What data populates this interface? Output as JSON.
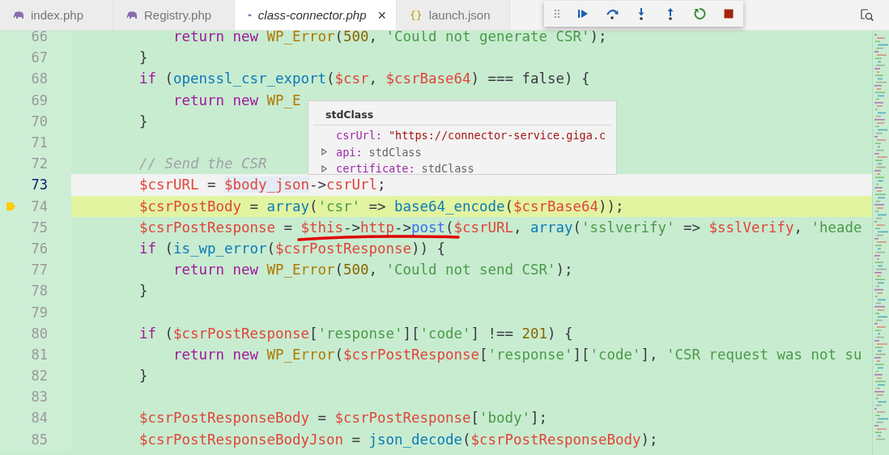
{
  "tabs": [
    {
      "label": "index.php",
      "kind": "php",
      "selected": false
    },
    {
      "label": "Registry.php",
      "kind": "php",
      "selected": false
    },
    {
      "label": "class-connector.php",
      "kind": "php",
      "selected": true,
      "close": "×"
    },
    {
      "label": "launch.json",
      "kind": "json",
      "glyph": "{}",
      "selected": false
    }
  ],
  "editor": {
    "lines": [
      {
        "number": "66",
        "kind": "plain",
        "tokens": [
          {
            "kind": "kw",
            "text": "            return"
          },
          {
            "kind": "kw",
            "text": " new"
          },
          {
            "kind": "cls",
            "text": " WP_Error"
          },
          {
            "kind": "p",
            "text": "("
          },
          {
            "kind": "num",
            "text": "500"
          },
          {
            "kind": "p",
            "text": ", "
          },
          {
            "kind": "str",
            "text": "'Could not generate CSR'"
          },
          {
            "kind": "p",
            "text": ");"
          }
        ]
      },
      {
        "number": "67",
        "kind": "plain",
        "tokens": [
          {
            "kind": "p",
            "text": "        }"
          }
        ]
      },
      {
        "number": "68",
        "kind": "plain",
        "tokens": [
          {
            "kind": "kw",
            "text": "        if"
          },
          {
            "kind": "p",
            "text": " ("
          },
          {
            "kind": "fn",
            "text": "openssl_csr_export"
          },
          {
            "kind": "p",
            "text": "("
          },
          {
            "kind": "var",
            "text": "$csr"
          },
          {
            "kind": "p",
            "text": ", "
          },
          {
            "kind": "var",
            "text": "$csrBase64"
          },
          {
            "kind": "p",
            "text": ") === false) {"
          }
        ]
      },
      {
        "number": "69",
        "kind": "plain",
        "tokens": [
          {
            "kind": "kw",
            "text": "            return"
          },
          {
            "kind": "kw",
            "text": " new"
          },
          {
            "kind": "cls",
            "text": " WP_E"
          }
        ]
      },
      {
        "number": "70",
        "kind": "plain",
        "tokens": [
          {
            "kind": "p",
            "text": "        }"
          }
        ]
      },
      {
        "number": "71",
        "kind": "plain"
      },
      {
        "number": "72",
        "kind": "plain",
        "tokens": [
          {
            "kind": "cmt",
            "text": "        // Send the CSR"
          }
        ]
      },
      {
        "number": "73",
        "kind": "cursor",
        "tokens": [
          {
            "kind": "var",
            "text": "        $csrURL"
          },
          {
            "kind": "p",
            "text": " = "
          },
          {
            "kind": "var-hover",
            "text": "$body_json"
          },
          {
            "kind": "p",
            "text": "->"
          },
          {
            "kind": "var",
            "text": "csrUrl"
          },
          {
            "kind": "p",
            "text": ";"
          }
        ]
      },
      {
        "number": "74",
        "kind": "paused",
        "tokens": [
          {
            "kind": "var",
            "text": "        $csrPostBody"
          },
          {
            "kind": "p",
            "text": " = "
          },
          {
            "kind": "fn",
            "text": "array"
          },
          {
            "kind": "p",
            "text": "("
          },
          {
            "kind": "str",
            "text": "'csr'"
          },
          {
            "kind": "p",
            "text": " => "
          },
          {
            "kind": "fn",
            "text": "base64_encode"
          },
          {
            "kind": "p",
            "text": "("
          },
          {
            "kind": "var",
            "text": "$csrBase64"
          },
          {
            "kind": "p",
            "text": "));"
          }
        ]
      },
      {
        "number": "75",
        "kind": "plain",
        "tokens": [
          {
            "kind": "var",
            "text": "        $csrPostResponse"
          },
          {
            "kind": "p",
            "text": " = "
          },
          {
            "kind": "var",
            "text": "$this"
          },
          {
            "kind": "p",
            "text": "->"
          },
          {
            "kind": "var",
            "text": "http"
          },
          {
            "kind": "p",
            "text": "->"
          },
          {
            "kind": "method",
            "text": "post"
          },
          {
            "kind": "p",
            "text": "("
          },
          {
            "kind": "var",
            "text": "$csrURL"
          },
          {
            "kind": "p",
            "text": ", "
          },
          {
            "kind": "fn",
            "text": "array"
          },
          {
            "kind": "p",
            "text": "("
          },
          {
            "kind": "str",
            "text": "'sslverify'"
          },
          {
            "kind": "p",
            "text": " => "
          },
          {
            "kind": "var",
            "text": "$sslVerify"
          },
          {
            "kind": "p",
            "text": ", "
          },
          {
            "kind": "str",
            "text": "'heade"
          }
        ]
      },
      {
        "number": "76",
        "kind": "plain",
        "tokens": [
          {
            "kind": "kw",
            "text": "        if"
          },
          {
            "kind": "p",
            "text": " ("
          },
          {
            "kind": "fn",
            "text": "is_wp_error"
          },
          {
            "kind": "p",
            "text": "("
          },
          {
            "kind": "var",
            "text": "$csrPostResponse"
          },
          {
            "kind": "p",
            "text": ")) {"
          }
        ]
      },
      {
        "number": "77",
        "kind": "plain",
        "tokens": [
          {
            "kind": "kw",
            "text": "            return"
          },
          {
            "kind": "kw",
            "text": " new"
          },
          {
            "kind": "cls",
            "text": " WP_Error"
          },
          {
            "kind": "p",
            "text": "("
          },
          {
            "kind": "num",
            "text": "500"
          },
          {
            "kind": "p",
            "text": ", "
          },
          {
            "kind": "str",
            "text": "'Could not send CSR'"
          },
          {
            "kind": "p",
            "text": ");"
          }
        ]
      },
      {
        "number": "78",
        "kind": "plain",
        "tokens": [
          {
            "kind": "p",
            "text": "        }"
          }
        ]
      },
      {
        "number": "79",
        "kind": "plain"
      },
      {
        "number": "80",
        "kind": "plain",
        "tokens": [
          {
            "kind": "kw",
            "text": "        if"
          },
          {
            "kind": "p",
            "text": " ("
          },
          {
            "kind": "var",
            "text": "$csrPostResponse"
          },
          {
            "kind": "p",
            "text": "["
          },
          {
            "kind": "str",
            "text": "'response'"
          },
          {
            "kind": "p",
            "text": "]["
          },
          {
            "kind": "str",
            "text": "'code'"
          },
          {
            "kind": "p",
            "text": "] !== "
          },
          {
            "kind": "num",
            "text": "201"
          },
          {
            "kind": "p",
            "text": ") {"
          }
        ]
      },
      {
        "number": "81",
        "kind": "plain",
        "tokens": [
          {
            "kind": "kw",
            "text": "            return"
          },
          {
            "kind": "kw",
            "text": " new"
          },
          {
            "kind": "cls",
            "text": " WP_Error"
          },
          {
            "kind": "p",
            "text": "("
          },
          {
            "kind": "var",
            "text": "$csrPostResponse"
          },
          {
            "kind": "p",
            "text": "["
          },
          {
            "kind": "str",
            "text": "'response'"
          },
          {
            "kind": "p",
            "text": "]["
          },
          {
            "kind": "str",
            "text": "'code'"
          },
          {
            "kind": "p",
            "text": "], "
          },
          {
            "kind": "str",
            "text": "'CSR request was not su"
          }
        ]
      },
      {
        "number": "82",
        "kind": "plain",
        "tokens": [
          {
            "kind": "p",
            "text": "        }"
          }
        ]
      },
      {
        "number": "83",
        "kind": "plain"
      },
      {
        "number": "84",
        "kind": "plain",
        "tokens": [
          {
            "kind": "var",
            "text": "        $csrPostResponseBody"
          },
          {
            "kind": "p",
            "text": " = "
          },
          {
            "kind": "var",
            "text": "$csrPostResponse"
          },
          {
            "kind": "p",
            "text": "["
          },
          {
            "kind": "str",
            "text": "'body'"
          },
          {
            "kind": "p",
            "text": "];"
          }
        ]
      },
      {
        "number": "85",
        "kind": "plain",
        "tokens": [
          {
            "kind": "var",
            "text": "        $csrPostResponseBodyJson"
          },
          {
            "kind": "p",
            "text": " = "
          },
          {
            "kind": "fn",
            "text": "json_decode"
          },
          {
            "kind": "p",
            "text": "("
          },
          {
            "kind": "var",
            "text": "$csrPostResponseBody"
          },
          {
            "kind": "p",
            "text": ");"
          }
        ]
      }
    ]
  },
  "hover": {
    "title": "stdClass",
    "rows": [
      {
        "key": "csrUrl:",
        "value": "\"https://connector-service.giga.c",
        "kind": "string",
        "expandable": false
      },
      {
        "key": "api:",
        "value": "stdClass",
        "kind": "type",
        "expandable": true
      },
      {
        "key": "certificate:",
        "value": "stdClass",
        "kind": "type",
        "expandable": true
      }
    ]
  }
}
